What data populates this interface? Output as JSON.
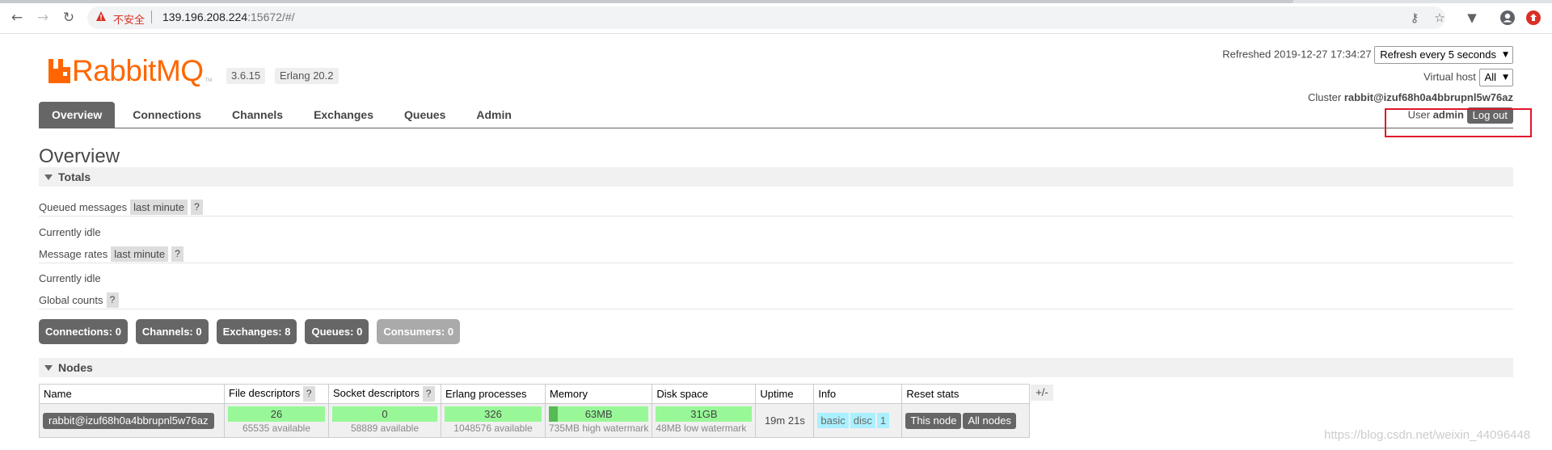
{
  "browser": {
    "insecure_label": "不安全",
    "url_host": "139.196.208.224",
    "url_rest": ":15672/#/"
  },
  "app": {
    "logo_text": "RabbitMQ",
    "logo_tm": "TM",
    "version": "3.6.15",
    "erlang": "Erlang 20.2",
    "accent": "#ff6600"
  },
  "header": {
    "refreshed_label": "Refreshed 2019-12-27 17:34:27",
    "refresh_select": "Refresh every 5 seconds",
    "vhost_label": "Virtual host",
    "vhost_select": "All",
    "cluster_label": "Cluster",
    "cluster_name": "rabbit@izuf68h0a4bbrupnl5w76az",
    "user_label": "User",
    "user_name": "admin",
    "logout_label": "Log out"
  },
  "tabs": [
    "Overview",
    "Connections",
    "Channels",
    "Exchanges",
    "Queues",
    "Admin"
  ],
  "page_title": "Overview",
  "totals": {
    "title": "Totals",
    "queued_label": "Queued messages",
    "queued_chip": "last minute",
    "queued_idle": "Currently idle",
    "rates_label": "Message rates",
    "rates_chip": "last minute",
    "rates_idle": "Currently idle",
    "global_label": "Global counts",
    "help": "?"
  },
  "counts": [
    {
      "label": "Connections:",
      "value": "0"
    },
    {
      "label": "Channels:",
      "value": "0"
    },
    {
      "label": "Exchanges:",
      "value": "8"
    },
    {
      "label": "Queues:",
      "value": "0"
    },
    {
      "label": "Consumers:",
      "value": "0"
    }
  ],
  "nodes": {
    "title": "Nodes",
    "plusminus": "+/-",
    "headers": [
      "Name",
      "File descriptors",
      "Socket descriptors",
      "Erlang processes",
      "Memory",
      "Disk space",
      "Uptime",
      "Info",
      "Reset stats"
    ],
    "row": {
      "name": "rabbit@izuf68h0a4bbrupnl5w76az",
      "fd_value": "26",
      "fd_sub": "65535 available",
      "sd_value": "0",
      "sd_sub": "58889 available",
      "ep_value": "326",
      "ep_sub": "1048576 available",
      "mem_value": "63MB",
      "mem_sub": "735MB high watermark",
      "mem_fraction": 0.086,
      "disk_value": "31GB",
      "disk_sub": "48MB low watermark",
      "uptime": "19m 21s",
      "info": [
        "basic",
        "disc",
        "1"
      ],
      "reset_this": "This node",
      "reset_all": "All nodes"
    }
  },
  "watermark": "https://blog.csdn.net/weixin_44096448"
}
